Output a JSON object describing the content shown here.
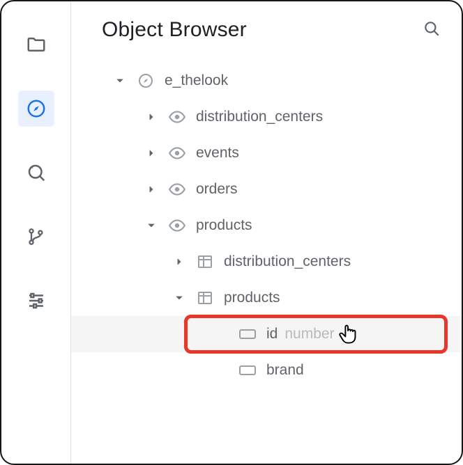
{
  "header": {
    "title": "Object Browser"
  },
  "tree": {
    "root": {
      "name": "e_thelook",
      "children": {
        "dc": {
          "name": "distribution_centers"
        },
        "events": {
          "name": "events"
        },
        "orders": {
          "name": "orders"
        },
        "products": {
          "name": "products",
          "children": {
            "dc2": {
              "name": "distribution_centers"
            },
            "products2": {
              "name": "products",
              "children": {
                "id": {
                  "name": "id",
                  "type": "number"
                },
                "brand": {
                  "name": "brand"
                }
              }
            }
          }
        }
      }
    }
  }
}
